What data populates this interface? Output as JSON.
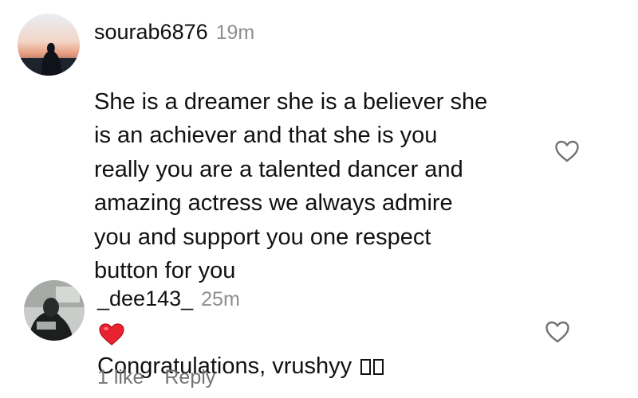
{
  "comments": [
    {
      "username": "sourab6876",
      "time": "19m",
      "text": "She is a dreamer she is a believer she\nis an achiever and that she is you\nreally you are a talented dancer and\namazing actress we always admire\nyou and support you one respect\nbutton for you",
      "emoji": "red-heart-emoji",
      "like_icon": "heart-outline-icon"
    },
    {
      "username": "_dee143_",
      "time": "25m",
      "text": "Congratulations, vrushyy",
      "emoji": "missing-glyph-boxes",
      "like_icon": "heart-outline-icon",
      "likes_label": "1 like",
      "reply_label": "Reply"
    }
  ]
}
